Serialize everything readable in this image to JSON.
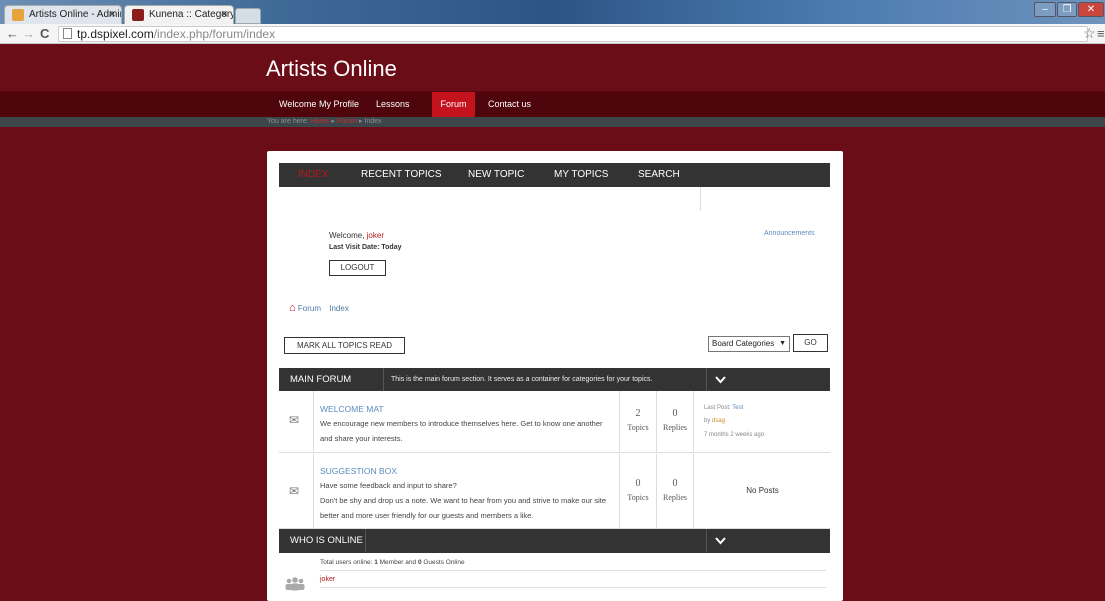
{
  "browser": {
    "tabs": [
      {
        "title": "Artists Online - Administr",
        "favicon_color": "#e8a43a"
      },
      {
        "title": "Kunena :: Category Index",
        "favicon_color": "#8b1c1c"
      }
    ],
    "url_host": "tp.dspixel.com",
    "url_path": "/index.php/forum/index",
    "win_minimize": "–",
    "win_restore": "❐",
    "win_close": "✕",
    "back_icon": "←",
    "forward_icon": "→",
    "reload_icon": "C",
    "star_icon": "☆",
    "menu_icon": "≡"
  },
  "site": {
    "title": "Artists Online",
    "nav": [
      "Welcome",
      "My Profile",
      "Lessons",
      "Forum",
      "Contact us"
    ],
    "active_nav": "Forum",
    "breadcrumb": {
      "prefix": "You are here:",
      "home": "Home",
      "sep1": "▸",
      "forum": "Forum",
      "sep2": "▸",
      "index": "Index"
    }
  },
  "forum": {
    "menu": [
      "INDEX",
      "RECENT TOPICS",
      "NEW TOPIC",
      "MY TOPICS",
      "SEARCH"
    ],
    "welcome_prefix": "Welcome, ",
    "username": "joker",
    "last_visit": "Last Visit Date: Today",
    "logout": "LOGOUT",
    "announcements": "Announcements",
    "breadcrumb": {
      "home_icon": "⌂",
      "forum": "Forum",
      "index": "Index"
    },
    "mark_all_read": "MARK ALL TOPICS READ",
    "board_select": "Board Categories",
    "go": "GO",
    "main_section": {
      "name": "MAIN FORUM",
      "description": "This is the main forum section. It serves as a container for categories for your topics.",
      "chevron": "⌄"
    },
    "categories": [
      {
        "title": "WELCOME MAT",
        "desc_line1": "We encourage new members to introduce themselves here. Get to know one another",
        "desc_line2": "and share your interests.",
        "topics": "2",
        "replies": "0",
        "topics_label": "Topics",
        "replies_label": "Replies",
        "last_post_prefix": "Last Post: ",
        "last_post_title": "Test",
        "by_prefix": "by ",
        "by_user": "dsag",
        "ago": "7 months 2 weeks ago"
      },
      {
        "title": "SUGGESTION BOX",
        "desc_line1": "Have some feedback and input to share?",
        "desc_line2": "Don't be shy and drop us a note. We want to hear from you and strive to make our site",
        "desc_line3": "better and more user friendly for our guests and members a like.",
        "topics": "0",
        "replies": "0",
        "topics_label": "Topics",
        "replies_label": "Replies",
        "no_posts": "No Posts"
      }
    ],
    "online_section": {
      "name": "WHO IS ONLINE",
      "chevron": "⌄",
      "total_prefix": "Total users online: ",
      "total_members": "1",
      "members_mid": " Member and ",
      "guests": "0",
      "guests_suffix": " Guests Online",
      "users": [
        "joker"
      ]
    },
    "mail_icon": "✉",
    "users_icon": "👥"
  }
}
